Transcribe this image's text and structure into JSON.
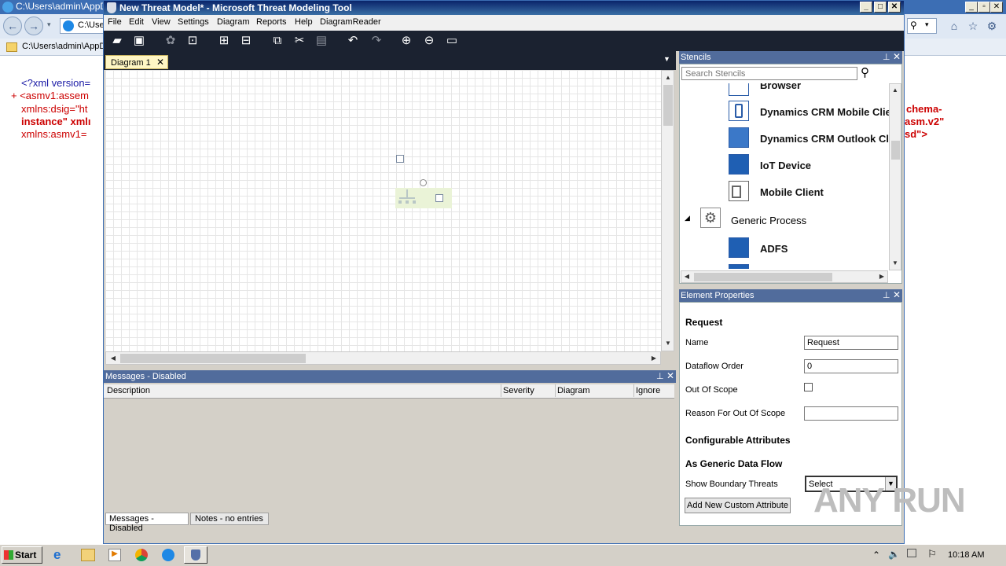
{
  "ie": {
    "title": "C:\\Users\\admin\\AppD",
    "address": "C:\\Use",
    "tab_label": "C:\\Users\\admin\\AppD",
    "xml_lines": [
      "<?xml version=",
      "+ <asmv1:assem",
      "xmlns:dsig=\"ht",
      "instance\" xmlı",
      "xmlns:asmv1="
    ],
    "xml_right": [
      "chema-",
      "asm.v2\"",
      "sd\">"
    ]
  },
  "tmt": {
    "title": "New Threat Model* - Microsoft Threat Modeling Tool",
    "menu": [
      "File",
      "Edit",
      "View",
      "Settings",
      "Diagram",
      "Reports",
      "Help",
      "DiagramReader"
    ],
    "doc_tab": "Diagram 1",
    "messages": {
      "title": "Messages - Disabled",
      "columns": [
        "Description",
        "Severity",
        "Diagram",
        "Ignore"
      ],
      "bottom_tabs": [
        "Messages - Disabled",
        "Notes - no entries"
      ]
    },
    "stencils": {
      "title": "Stencils",
      "search_placeholder": "Search Stencils",
      "items": [
        {
          "label": "Browser",
          "icon": "browser-icon"
        },
        {
          "label": "Dynamics CRM Mobile Clier",
          "icon": "mobile-crm-icon"
        },
        {
          "label": "Dynamics CRM Outlook Cli",
          "icon": "outlook-crm-icon"
        },
        {
          "label": "IoT Device",
          "icon": "iot-device-icon"
        },
        {
          "label": "Mobile Client",
          "icon": "mobile-client-icon"
        },
        {
          "label": "Generic Process",
          "icon": "gear-icon"
        },
        {
          "label": "ADFS",
          "icon": "adfs-icon"
        }
      ]
    },
    "properties": {
      "title": "Element Properties",
      "heading": "Request",
      "name_label": "Name",
      "name_value": "Request",
      "dataflow_label": "Dataflow Order",
      "dataflow_value": "0",
      "scope_label": "Out Of Scope",
      "reason_label": "Reason For Out Of Scope",
      "reason_value": "",
      "configurable": "Configurable Attributes",
      "generic_flow": "As Generic Data Flow",
      "boundary_label": "Show Boundary Threats",
      "boundary_value": "Select",
      "add_button": "Add New Custom Attribute"
    }
  },
  "taskbar": {
    "start": "Start",
    "clock": "10:18 AM"
  },
  "watermark": "ANY RUN"
}
